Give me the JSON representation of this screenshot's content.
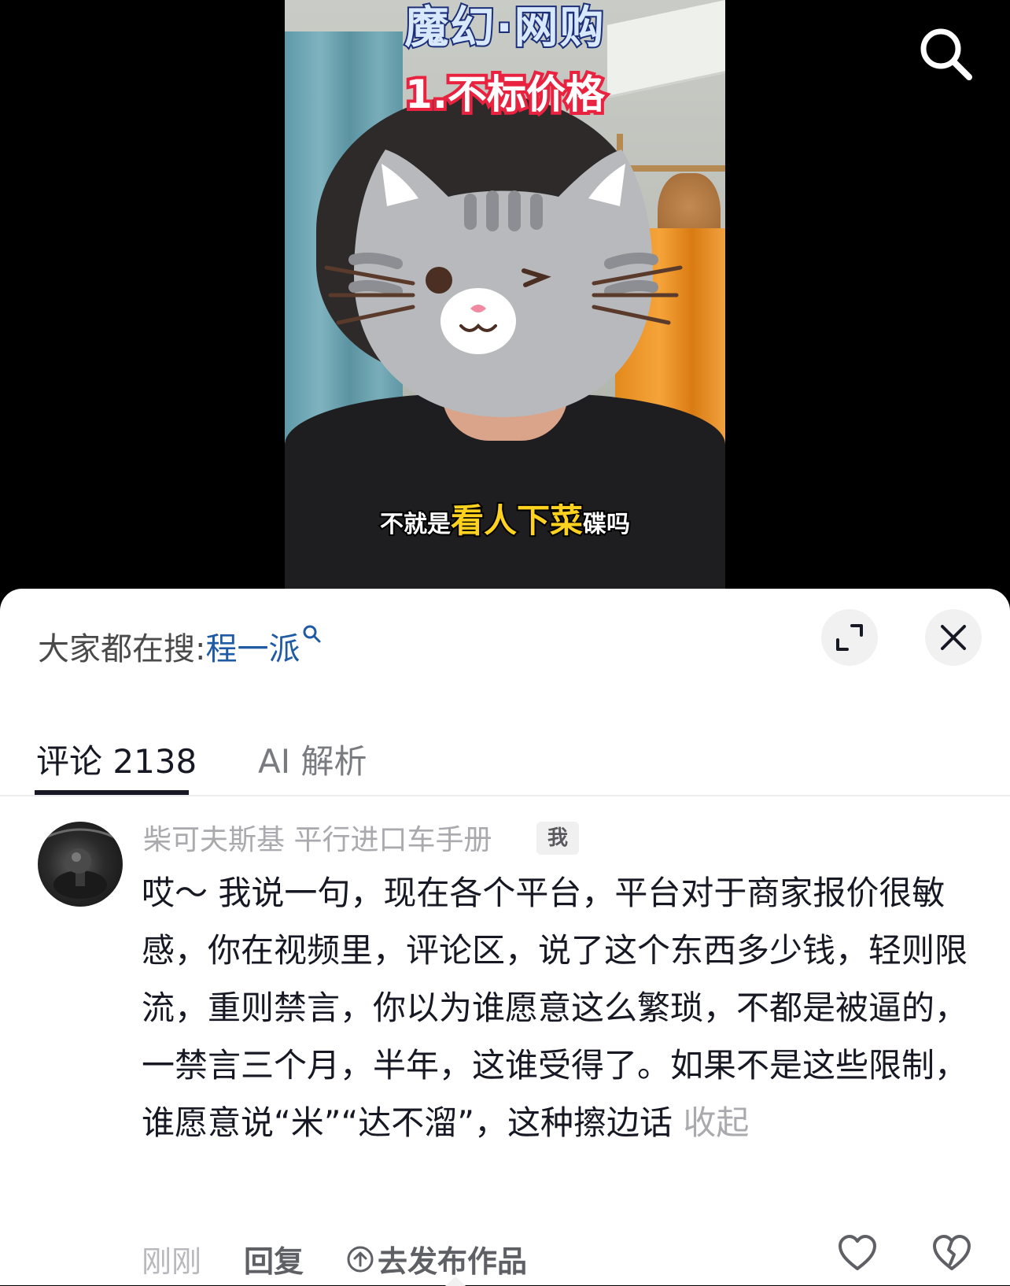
{
  "video": {
    "title": "魔幻·网购",
    "subtitle": "1.不标价格",
    "caption_pre": "不就是",
    "caption_highlight": "看人下菜",
    "caption_post": "碟吗",
    "search_icon": "search-icon"
  },
  "sheet": {
    "hot_search_label": "大家都在搜:",
    "hot_search_keyword": "程一派",
    "expand_icon": "expand-icon",
    "close_icon": "close-icon"
  },
  "tabs": {
    "comments_label": "评论 2138",
    "ai_label": "AI 解析",
    "active": "comments"
  },
  "comment": {
    "username": "柴可夫斯基 平行进口车手册",
    "badge": "我",
    "text": "哎～ 我说一句，现在各个平台，平台对于商家报价很敏感，你在视频里，评论区，说了这个东西多少钱，轻则限流，重则禁言，你以为谁愿意这么繁琐，不都是被逼的，一禁言三个月，半年，这谁受得了。如果不是这些限制，谁愿意说“米”“达不溜”，这种擦边话",
    "collapse_label": "收起",
    "time": "刚刚",
    "reply_label": "回复",
    "publish_label": "去发布作品",
    "like_icon": "heart-icon",
    "dislike_icon": "broken-heart-icon"
  },
  "colors": {
    "keyword_blue": "#1f5aa5",
    "text_primary": "#161823",
    "text_muted": "#a9a9ae"
  }
}
